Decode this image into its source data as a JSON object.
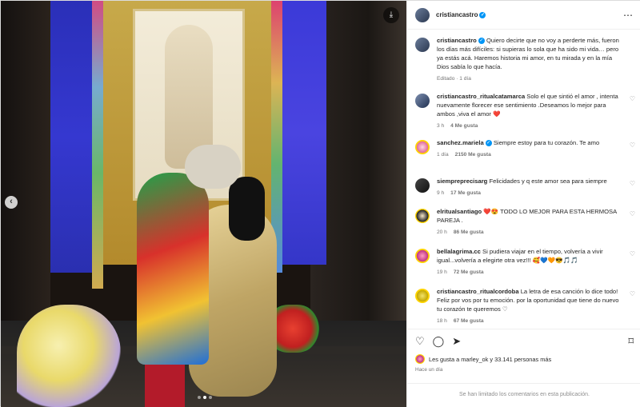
{
  "post": {
    "author": "cristiancastro",
    "caption_text": "Quiero decirte que no voy a perderte más, fueron los días más difíciles: si supieras lo sola que ha sido mi vida… pero ya estás acá. Haremos historia mi amor, en tu mirada y en la mía Dios sabía lo que hacía.",
    "caption_meta": "Editado · 1 día",
    "likes_text": "Les gusta a marley_ok y 33.141 personas más",
    "timestamp": "Hace un día",
    "comments_limited": "Se han limitado los comentarios en esta publicación."
  },
  "comments": [
    {
      "user": "cristiancastro_ritualcatamarca",
      "text": "Solo el que sintió el amor , intenta nuevamente florecer ese sentimiento .Deseamos lo mejor para ambos ,viva el amor ❤️",
      "time": "3 h",
      "likes": "4 Me gusta"
    },
    {
      "user": "sanchez.mariela",
      "text": "Siempre estoy para tu corazón. Te amo",
      "time": "1 día",
      "likes": "2150 Me gusta"
    },
    {
      "user": "siempreprecisarg",
      "text": "Felicidades y q este amor sea para siempre",
      "time": "9 h",
      "likes": "17 Me gusta"
    },
    {
      "user": "elritualsantiago",
      "text": "❤️😍 TODO LO MEJOR PARA ESTA HERMOSA PAREJA .",
      "time": "20 h",
      "likes": "86 Me gusta"
    },
    {
      "user": "bellalagrima.cc",
      "text": "Si pudiera viajar en el tiempo, volvería a vivir igual...volvería a elegirte otra vez!!! 🥰💙🧡😎🎵🎵",
      "time": "19 h",
      "likes": "72 Me gusta"
    },
    {
      "user": "cristiancastro_ritualcordoba",
      "text": "La letra de esa canción lo dice todo! Feliz por vos por tu emoción. por la oportunidad que tiene do nuevo tu corazón te queremos ♡",
      "time": "18 h",
      "likes": "67 Me gusta"
    }
  ],
  "icons": {
    "download": "⤓",
    "prev": "‹",
    "more": "⋯",
    "verified": "✓",
    "heart": "♡",
    "comment": "◯",
    "share": "➤",
    "bookmark": "⌑"
  },
  "colors": {
    "verified_blue": "#0095f6",
    "text": "#262626",
    "muted": "#737373"
  }
}
